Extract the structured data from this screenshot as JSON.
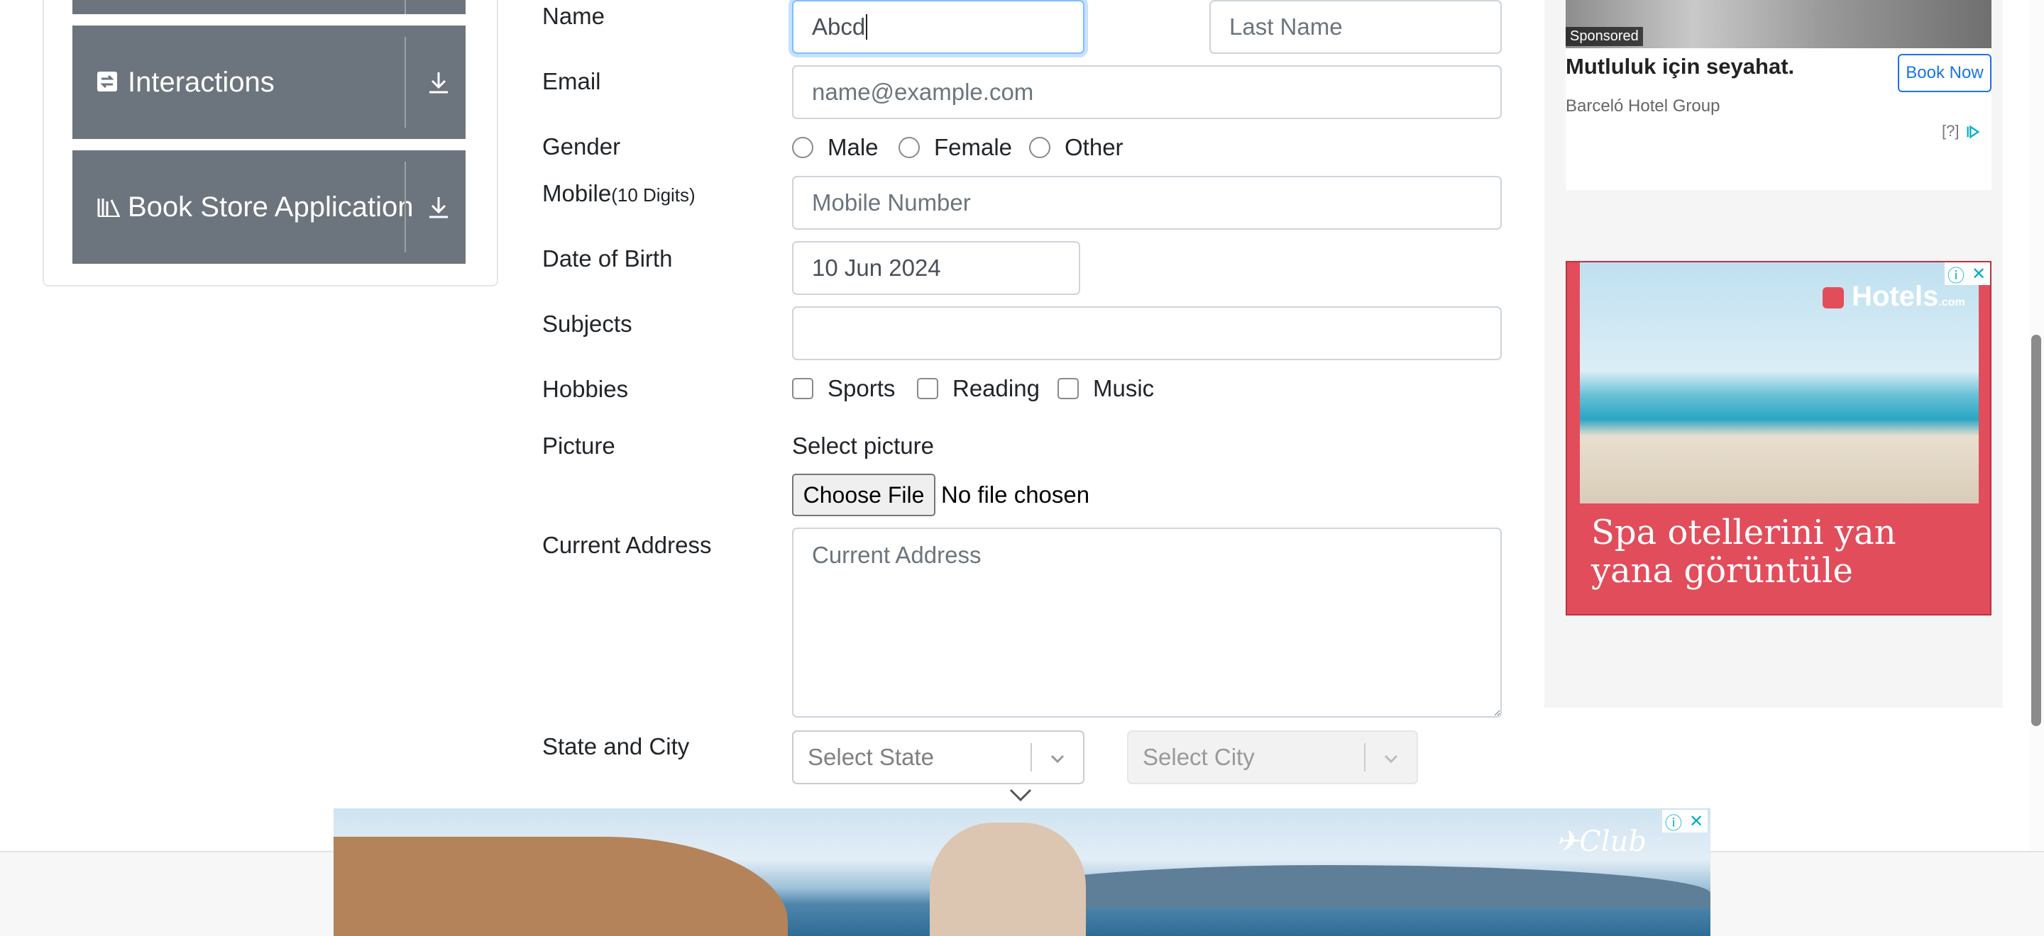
{
  "sidebar": {
    "items": [
      {
        "label": ""
      },
      {
        "label": "Interactions"
      },
      {
        "label": "Book Store Application"
      }
    ]
  },
  "form": {
    "name_label": "Name",
    "first_name_value": "Abcd",
    "last_name_placeholder": "Last Name",
    "email_label": "Email",
    "email_placeholder": "name@example.com",
    "gender_label": "Gender",
    "gender_options": [
      "Male",
      "Female",
      "Other"
    ],
    "mobile_label": "Mobile",
    "mobile_hint": "(10 Digits)",
    "mobile_placeholder": "Mobile Number",
    "dob_label": "Date of Birth",
    "dob_value": "10 Jun 2024",
    "subjects_label": "Subjects",
    "hobbies_label": "Hobbies",
    "hobby_options": [
      "Sports",
      "Reading",
      "Music"
    ],
    "picture_label": "Picture",
    "select_picture_text": "Select picture",
    "choose_file_label": "Choose File",
    "no_file_text": "No file chosen",
    "address_label": "Current Address",
    "address_placeholder": "Current Address",
    "state_city_label": "State and City",
    "state_placeholder": "Select State",
    "city_placeholder": "Select City"
  },
  "ads": {
    "sponsored": "Sponsored",
    "hotel_title": "Mutluluk için seyahat.",
    "hotel_advertiser": "Barceló Hotel Group",
    "book_now": "Book Now",
    "ad_choices": "[?]",
    "hotels_brand": "Hotels",
    "hotels_brand_suffix": ".com",
    "hotels_headline": "Spa otellerini yan yana görüntüle",
    "banner_brand": "Club"
  },
  "colors": {
    "accordion": "#6c757d",
    "focus": "#80bdff",
    "ad_red": "#e24d5b",
    "link_blue": "#1a73e8"
  }
}
